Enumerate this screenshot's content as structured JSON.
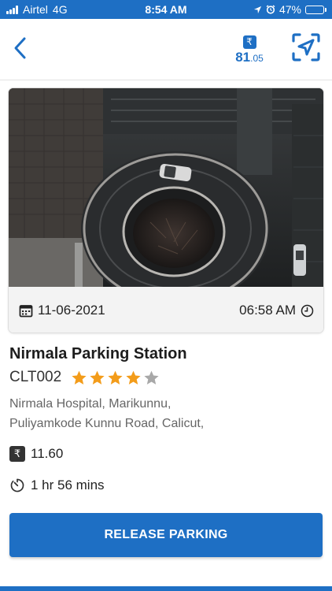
{
  "status_bar": {
    "carrier": "Airtel",
    "network": "4G",
    "time": "8:54 AM",
    "battery": "47%",
    "battery_level": 0.47
  },
  "header": {
    "wallet_currency_symbol": "₹",
    "wallet_amount_whole": "81",
    "wallet_amount_decimal": ".05",
    "icons": [
      "back-chevron-icon",
      "rupee-icon",
      "locate-navigation-icon"
    ]
  },
  "booking": {
    "date": "11-06-2021",
    "time": "06:58 AM",
    "station_name": "Nirmala Parking Station",
    "station_code": "CLT002",
    "rating": 4,
    "rating_max": 5,
    "address_line1": "Nirmala Hospital, Marikunnu,",
    "address_line2": "Puliyamkode Kunnu Road, Calicut,",
    "price_symbol": "₹",
    "price": "11.60",
    "duration": "1 hr 56 mins"
  },
  "actions": {
    "release_label": "RELEASE PARKING"
  },
  "colors": {
    "primary": "#1e6fc4",
    "star_filled": "#f39c1a",
    "star_empty": "#a8a8a8"
  }
}
